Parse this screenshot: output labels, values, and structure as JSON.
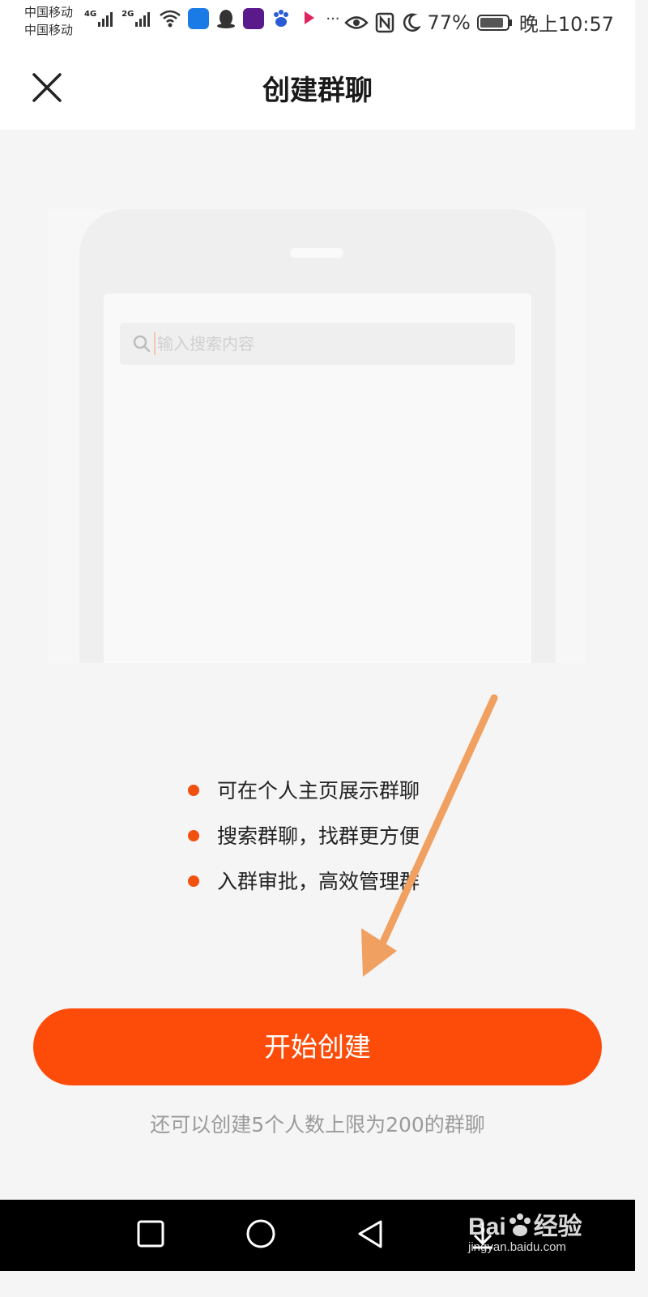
{
  "status_bar": {
    "carrier1": "中国移动",
    "carrier2": "中国移动",
    "net1": "4G",
    "net2": "2G",
    "more": "···",
    "battery": "77%",
    "time": "晚上10:57"
  },
  "header": {
    "title": "创建群聊",
    "close_icon": "close-icon"
  },
  "illustration": {
    "search_placeholder": "输入搜索内容"
  },
  "features": [
    "可在个人主页展示群聊",
    "搜索群聊，找群更方便",
    "入群审批，高效管理群"
  ],
  "actions": {
    "start_label": "开始创建",
    "quota_text": "还可以创建5个人数上限为200的群聊"
  },
  "watermark": {
    "brand": "Bai",
    "brand_suffix": "经验",
    "domain": "jingyan.baidu.com"
  },
  "colors": {
    "accent": "#fd4c0a",
    "bullet": "#f2500f",
    "annotation_arrow": "#f0a060"
  }
}
